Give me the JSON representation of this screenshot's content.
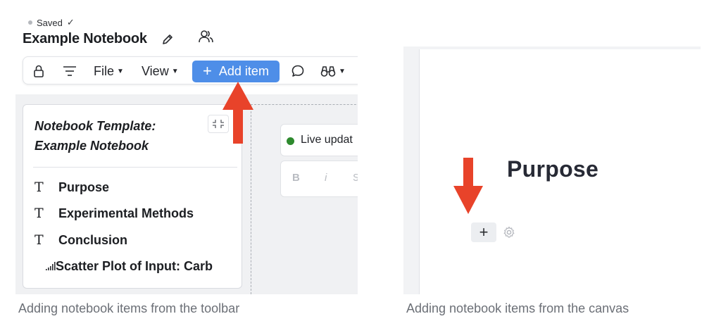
{
  "left_panel": {
    "status": "Saved",
    "notebook_title": "Example Notebook",
    "toolbar": {
      "file_label": "File",
      "view_label": "View",
      "add_item_label": "Add item"
    },
    "template_card": {
      "title_line1": "Notebook Template:",
      "title_line2": "Example Notebook",
      "items": [
        {
          "icon": "text-icon",
          "label": "Purpose"
        },
        {
          "icon": "text-icon",
          "label": "Experimental Methods"
        },
        {
          "icon": "text-icon",
          "label": "Conclusion"
        },
        {
          "icon": "chart-bars-icon",
          "label": "Scatter Plot of Input: Carb"
        }
      ]
    },
    "live_label": "Live updat",
    "format_buttons": {
      "bold": "B",
      "italic": "i"
    }
  },
  "right_panel": {
    "heading": "Purpose",
    "add_symbol": "+"
  },
  "captions": {
    "left": "Adding notebook items from the toolbar",
    "right": "Adding notebook items from the canvas"
  },
  "colors": {
    "accent_blue": "#4e8ee8",
    "arrow_red": "#e8432a",
    "live_green": "#2e8a2e"
  }
}
